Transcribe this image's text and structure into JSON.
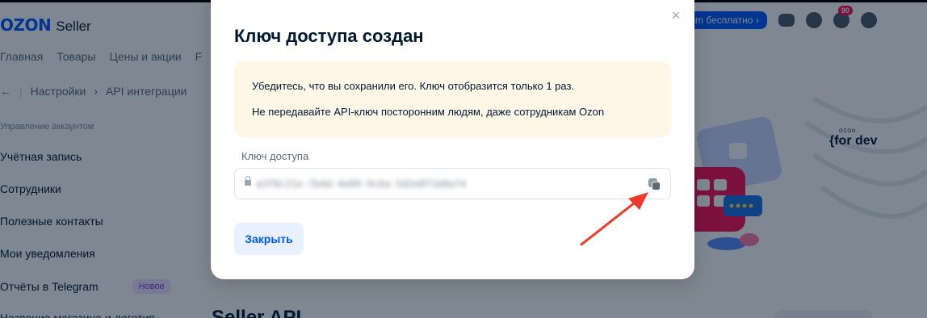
{
  "header": {
    "logo_brand": "OZON",
    "logo_product": "Seller",
    "premium_label": "lium бесплатно",
    "premium_chevron": "›",
    "notifications_count": "90"
  },
  "nav": {
    "items": [
      "Главная",
      "Товары",
      "Цены и акции",
      "F"
    ]
  },
  "breadcrumbs": {
    "back": "←",
    "separator": "|",
    "item1": "Настройки",
    "chevron": "›",
    "item2": "API интеграции"
  },
  "sidebar": {
    "section_title": "Управление аккаунтом",
    "items": [
      "Учётная запись",
      "Сотрудники",
      "Полезные контакты",
      "Мои уведомления",
      "Отчёты в Telegram",
      "Название магазина и логотип"
    ],
    "new_badge": "Новое"
  },
  "promo": {
    "brand_small": "OZON",
    "brand_big": "{for dev"
  },
  "page": {
    "heading_partial": "Seller API"
  },
  "modal": {
    "title": "Ключ доступа создан",
    "close_icon": "×",
    "notice_line1": "Убедитесь, что вы сохранили его. Ключ отобразится только 1 раз.",
    "notice_line2": "Не передавайте API-ключ посторонним людям, даже сотрудникам Ozon",
    "field_label": "Ключ доступа",
    "key_value": "a3f8c21e-7b4d-4e09-9c6a-5d2e8f1b0a74",
    "close_button": "Закрыть"
  },
  "colors": {
    "brand_blue": "#005bff",
    "notice_bg": "#fef6e6",
    "overlay": "rgba(0,18,38,0.5)",
    "annotation_arrow": "#f0392b",
    "badge_new_bg": "#efe3ff",
    "notification_badge": "#f91155"
  },
  "icons": {
    "lock": "lock-icon",
    "copy": "copy-icon",
    "close": "close-icon",
    "chat": "chat-icon",
    "support": "headset-icon",
    "bell": "bell-icon",
    "profile": "user-icon",
    "back": "arrow-left-icon"
  }
}
